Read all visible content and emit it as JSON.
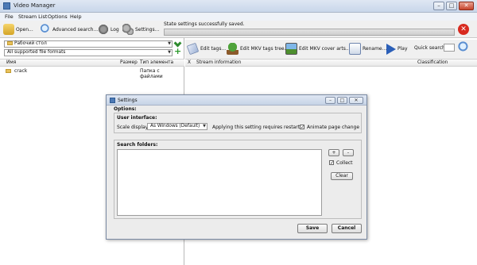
{
  "window": {
    "title": "Video Manager",
    "menu": [
      "File",
      "Stream List",
      "Options",
      "Help"
    ],
    "controls": {
      "minimize": "–",
      "maximize": "□",
      "close": "✕"
    }
  },
  "toolbar": {
    "open_label": "Open...",
    "advanced_search_label": "Advanced search...",
    "log_label": "Log",
    "settings_label": "Settings...",
    "status_text": "State settings successfully saved.",
    "stop_symbol": "✕"
  },
  "left_panel": {
    "location_combo": "Рабочий стол",
    "filter_combo": "All supported file formats",
    "columns": {
      "name": "Имя",
      "size": "Размер",
      "type": "Тип элемента"
    },
    "rows": [
      {
        "name": "crack",
        "size": "",
        "type": "Папка с файлами"
      }
    ]
  },
  "right_panel": {
    "buttons": {
      "edit_tags": "Edit tags...",
      "edit_mkv_tags_tree": "Edit MKV tags tree...",
      "edit_mkv_cover_arts": "Edit MKV cover arts...",
      "rename": "Rename...",
      "play": "Play",
      "quick_search": "Quick search:"
    },
    "columns": {
      "x": "X",
      "stream_info": "Stream information",
      "classification": "Classification"
    }
  },
  "dialog": {
    "title": "Settings",
    "options_label": "Options:",
    "user_interface_label": "User interface:",
    "scale_display_label": "Scale display:",
    "scale_display_value": "As Windows (Default)",
    "restart_note": "Applying this setting requires restart.",
    "animate_label": "Animate page change",
    "animate_checked": "✓",
    "search_folders_label": "Search folders:",
    "add_symbol": "+",
    "remove_symbol": "-",
    "collect_label": "Collect",
    "collect_checked": "✓",
    "clear_label": "Clear",
    "save_label": "Save",
    "cancel_label": "Cancel",
    "controls": {
      "minimize": "–",
      "maximize": "□",
      "close": "✕"
    }
  },
  "colors": {
    "accent": "#4c79b5",
    "stop": "#d82a1f",
    "folder": "#e8c15b"
  },
  "icons": {
    "open": "open-folder-icon",
    "search": "magnifier-icon",
    "log": "gear-log-icon",
    "settings": "gears-icon",
    "edit_tags": "tag-icon",
    "tree": "tree-icon",
    "cover": "picture-icon",
    "rename": "rename-icon",
    "play": "play-icon"
  }
}
